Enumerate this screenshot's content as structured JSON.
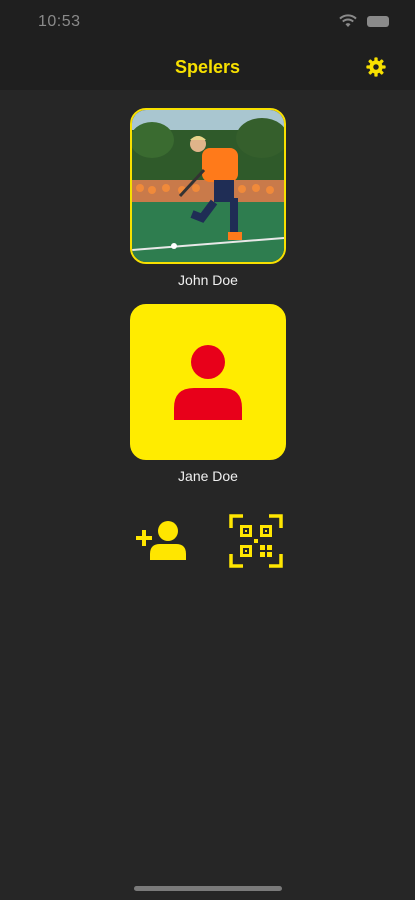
{
  "status_bar": {
    "time": "10:53"
  },
  "nav": {
    "title": "Spelers",
    "settings_icon": "gear-icon"
  },
  "players": [
    {
      "name": "John Doe",
      "card_type": "photo"
    },
    {
      "name": "Jane Doe",
      "card_type": "avatar-placeholder",
      "avatar_icon": "person-icon"
    }
  ],
  "actions": {
    "add_player_icon": "add-person-icon",
    "scan_icon": "qr-scan-icon"
  },
  "colors": {
    "accent": "#f7e000",
    "avatar_bg": "#ffec00",
    "avatar_icon": "#e8001a",
    "background": "#262626"
  }
}
